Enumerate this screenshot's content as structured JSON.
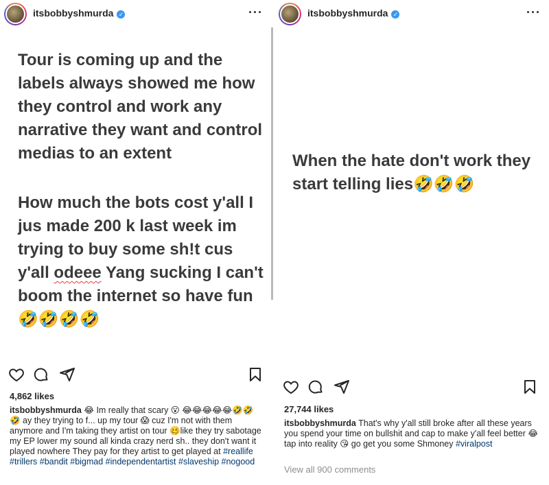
{
  "left_post": {
    "username": "itsbobbyshmurda",
    "image_text_p1": "Tour is coming up and the labels always showed me how they control and work any narrative they want and control medias to an extent",
    "image_text_p2_a": "How much the bots cost y'all I jus made 200 k last week im trying to buy some sh!t cus y'all ",
    "image_text_p2_word": "odeee",
    "image_text_p2_b": " Yang sucking I can't boom the internet so have fun🤣🤣🤣🤣",
    "likes": "4,862 likes",
    "caption_user": "itsbobbyshmurda",
    "caption_text": "😂 Im really that scary 😮 😂😂😂😂😂🤣🤣🤣 ay they trying to f... up my tour 😱 cuz I'm not with them anymore and I'm taking they artist on tour 🥴like they try sabotage my EP lower my sound all kinda crazy nerd sh.. they don't want it played nowhere They pay for they artist to get played at ",
    "hashtags": "#reallife #trillers #bandit #bigmad #independentartist #slaveship #nogood"
  },
  "right_post": {
    "username": "itsbobbyshmurda",
    "image_text_p1": "When the hate don't work they start telling lies🤣🤣🤣",
    "likes": "27,744 likes",
    "caption_user": "itsbobbyshmurda",
    "caption_text": "That's why y'all still broke after all these years you spend your time on bullshit and cap to make y'all feel better 😂 tap into reality 😘 go get you some Shmoney ",
    "hashtags": "#viralpost",
    "view_all": "View all 900 comments"
  },
  "icons": [
    "heart-icon",
    "comment-icon",
    "share-icon",
    "bookmark-icon",
    "more-options-icon",
    "verified-badge-icon"
  ],
  "colors": {
    "verified": "#3897f0",
    "hashtag": "#00376b",
    "muted": "#8e8e8e",
    "text": "#262626"
  }
}
